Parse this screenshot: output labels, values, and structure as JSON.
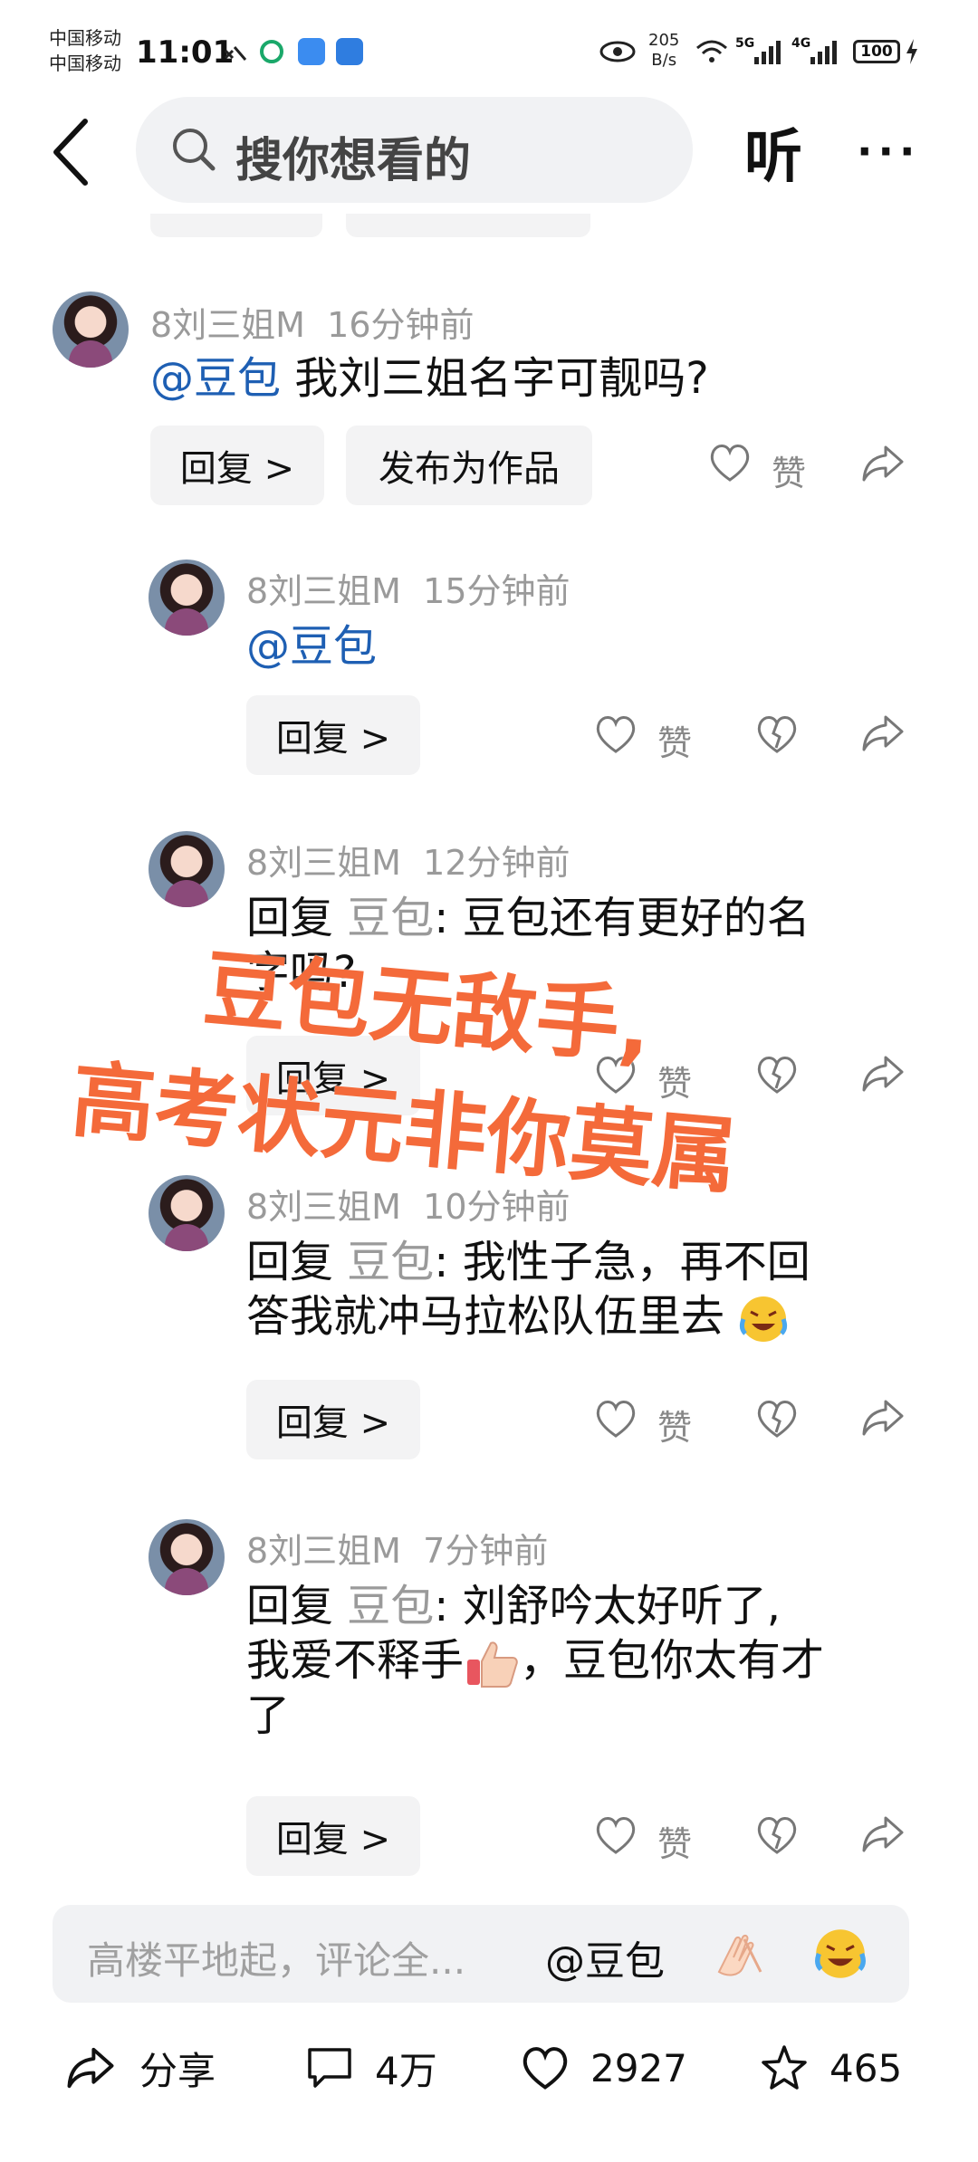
{
  "status_bar": {
    "carrier_1": "中国移动",
    "carrier_2": "中国移动",
    "time": "11:01",
    "net_speed_value": "205",
    "net_speed_unit": "B/s",
    "signal_1": "5G",
    "signal_2": "4G",
    "battery": "100"
  },
  "header": {
    "search_placeholder": "搜你想看的",
    "listen_label": "听",
    "more_label": "···"
  },
  "comments": [
    {
      "user": "8刘三姐M",
      "time": "16分钟前",
      "mention": "@豆包",
      "text": " 我刘三姐名字可靓吗?",
      "reply_label": "回复 >",
      "publish_label": "发布为作品",
      "like_label": "赞"
    },
    {
      "user": "8刘三姐M",
      "time": "15分钟前",
      "mention": "@豆包",
      "reply_label": "回复 >",
      "like_label": "赞"
    },
    {
      "user": "8刘三姐M",
      "time": "12分钟前",
      "reply_prefix": "回复 ",
      "reply_to": "豆包",
      "text_line1": ": 豆包还有更好的名",
      "text_line2": "字吗?",
      "reply_label": "回复 >",
      "like_label": "赞"
    },
    {
      "user": "8刘三姐M",
      "time": "10分钟前",
      "reply_prefix": "回复 ",
      "reply_to": "豆包",
      "text_line1": ": 我性子急，再不回",
      "text_line2": "答我就冲马拉松队伍里去",
      "reply_label": "回复 >",
      "like_label": "赞"
    },
    {
      "user": "8刘三姐M",
      "time": "7分钟前",
      "reply_prefix": "回复 ",
      "reply_to": "豆包",
      "text_line1": ": 刘舒吟太好听了,",
      "text_line2a": "我爱不释手",
      "text_line2b": "，豆包你太有才",
      "text_line3": "了",
      "reply_label": "回复 >",
      "like_label": "赞"
    }
  ],
  "overlay": {
    "line1": "豆包无敌手,",
    "line2": "高考状元非你莫属"
  },
  "input_bar": {
    "placeholder": "高楼平地起，评论全...",
    "mention": "@豆包"
  },
  "bottom_bar": {
    "share_label": "分享",
    "comments_count": "4万",
    "likes_count": "2927",
    "favorites_count": "465"
  },
  "colors": {
    "mention_blue": "#1e5fb3",
    "overlay_orange": "#f46a3a",
    "button_bg": "#f3f3f4"
  }
}
